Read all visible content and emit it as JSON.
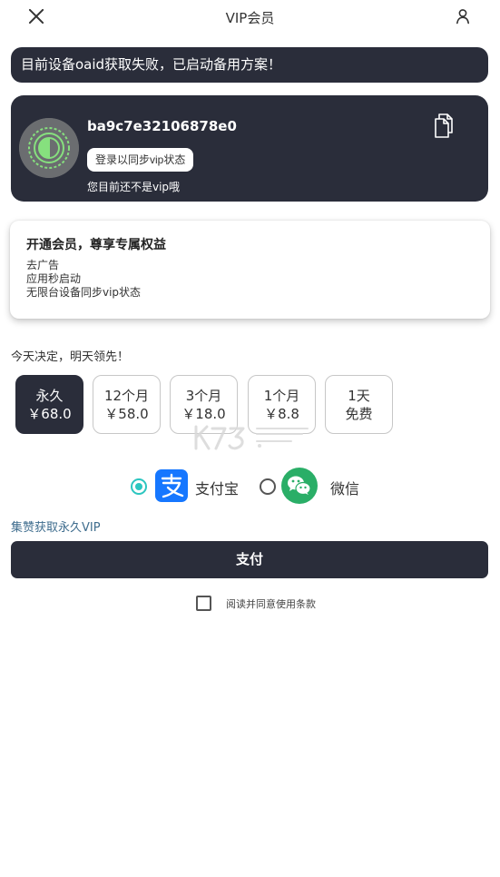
{
  "header": {
    "title": "VIP会员",
    "close_icon": "close-icon",
    "user_icon": "user-icon"
  },
  "notice": {
    "text": "目前设备oaid获取失败，已启动备用方案！"
  },
  "profile": {
    "device_id": "ba9c7e32106878e0",
    "login_sync_label": "登录以同步vip状态",
    "vip_status": "您目前还不是vip哦",
    "copy_icon": "copy-icon",
    "avatar_icon": "app-logo-avatar"
  },
  "benefits": {
    "title": "开通会员，尊享专属权益",
    "items": [
      "去广告",
      "应用秒启动",
      "无限台设备同步vip状态"
    ]
  },
  "slogan": "今天决定，明天领先！",
  "plans": [
    {
      "name": "永久",
      "price": "￥68.0",
      "selected": true
    },
    {
      "name": "12个月",
      "price": "￥58.0",
      "selected": false
    },
    {
      "name": "3个月",
      "price": "￥18.0",
      "selected": false
    },
    {
      "name": "1个月",
      "price": "￥8.8",
      "selected": false
    },
    {
      "name": "1天",
      "price": "免费",
      "selected": false
    }
  ],
  "payment": {
    "alipay": {
      "label": "支付宝",
      "icon": "alipay-icon",
      "selected": true
    },
    "wechat": {
      "label": "微信",
      "icon": "wechat-icon",
      "selected": false
    }
  },
  "promo_link": "集赞获取永久VIP",
  "pay_button_label": "支付",
  "agreement": {
    "label": "阅读并同意使用条款",
    "checked": false
  },
  "colors": {
    "dark": "#2a2d3a",
    "accent": "#2cc6c0",
    "alipay": "#1677ff",
    "wechat": "#2aae67",
    "link": "#3f6d8e"
  }
}
